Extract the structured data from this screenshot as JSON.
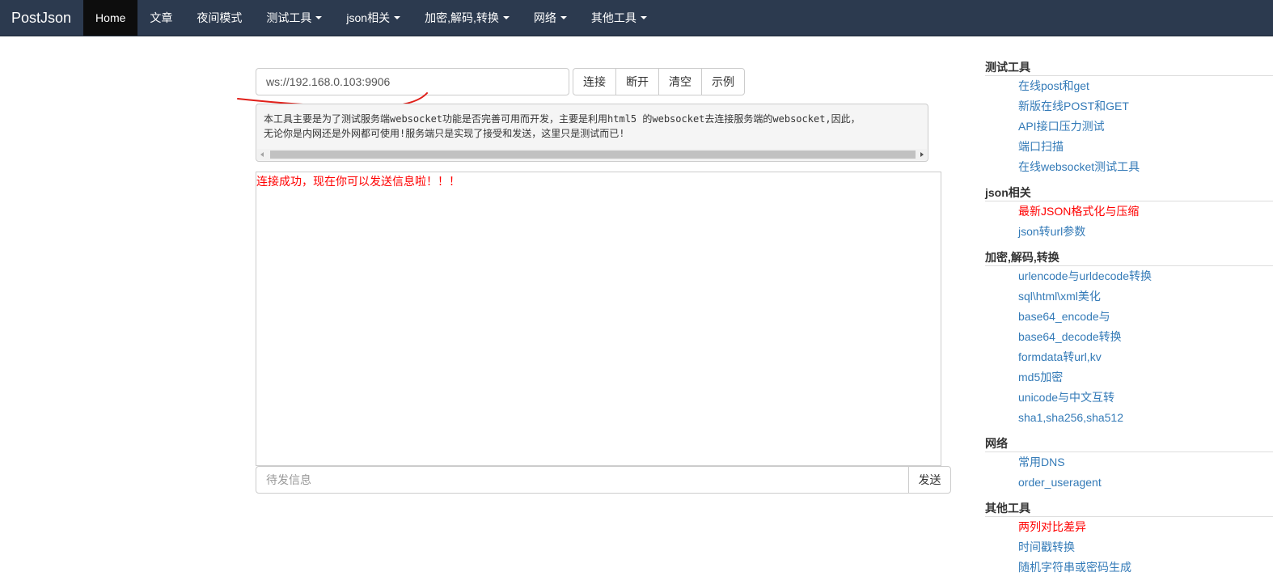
{
  "navbar": {
    "brand": "PostJson",
    "items": [
      {
        "label": "Home",
        "active": true,
        "dropdown": false
      },
      {
        "label": "文章",
        "active": false,
        "dropdown": false
      },
      {
        "label": "夜间模式",
        "active": false,
        "dropdown": false
      },
      {
        "label": "测试工具",
        "active": false,
        "dropdown": true
      },
      {
        "label": "json相关",
        "active": false,
        "dropdown": true
      },
      {
        "label": "加密,解码,转换",
        "active": false,
        "dropdown": true
      },
      {
        "label": "网络",
        "active": false,
        "dropdown": true
      },
      {
        "label": "其他工具",
        "active": false,
        "dropdown": true
      }
    ]
  },
  "connect": {
    "url_value": "ws://192.168.0.103:9906",
    "buttons": [
      "连接",
      "断开",
      "清空",
      "示例"
    ]
  },
  "description": {
    "line1": "本工具主要是为了测试服务端websocket功能是否完善可用而开发，主要是利用html5 的websocket去连接服务端的websocket,因此，",
    "line2": "无论你是内网还是外网都可使用!服务端只是实现了接受和发送，这里只是测试而已!"
  },
  "messages": [
    "连接成功，现在你可以发送信息啦！！！"
  ],
  "send": {
    "placeholder": "待发信息",
    "button": "发送"
  },
  "sidebar": [
    {
      "title": "测试工具",
      "links": [
        {
          "label": "在线post和get",
          "hot": false
        },
        {
          "label": "新版在线POST和GET",
          "hot": false
        },
        {
          "label": "API接口压力测试",
          "hot": false
        },
        {
          "label": "端口扫描",
          "hot": false
        },
        {
          "label": "在线websocket测试工具",
          "hot": false
        }
      ]
    },
    {
      "title": "json相关",
      "links": [
        {
          "label": "最新JSON格式化与压缩",
          "hot": true
        },
        {
          "label": "json转url参数",
          "hot": false
        }
      ]
    },
    {
      "title": "加密,解码,转换",
      "links": [
        {
          "label": "urlencode与urldecode转换",
          "hot": false
        },
        {
          "label": "sql\\html\\xml美化",
          "hot": false
        },
        {
          "label": "base64_encode与",
          "hot": false
        },
        {
          "label": "base64_decode转换",
          "hot": false
        },
        {
          "label": "formdata转url,kv",
          "hot": false
        },
        {
          "label": "md5加密",
          "hot": false
        },
        {
          "label": "unicode与中文互转",
          "hot": false
        },
        {
          "label": "sha1,sha256,sha512",
          "hot": false
        }
      ]
    },
    {
      "title": "网络",
      "links": [
        {
          "label": "常用DNS",
          "hot": false
        },
        {
          "label": "order_useragent",
          "hot": false
        }
      ]
    },
    {
      "title": "其他工具",
      "links": [
        {
          "label": "两列对比差异",
          "hot": true
        },
        {
          "label": "时间戳转换",
          "hot": false
        },
        {
          "label": "随机字符串或密码生成",
          "hot": false
        }
      ]
    }
  ],
  "colors": {
    "navbar_bg": "#2c3a4f",
    "nav_active_bg": "#0d0d0d",
    "link": "#337ab7",
    "hot_link": "#ff0000",
    "status_message": "#ff0000",
    "annotation_stroke": "#e0201a"
  }
}
